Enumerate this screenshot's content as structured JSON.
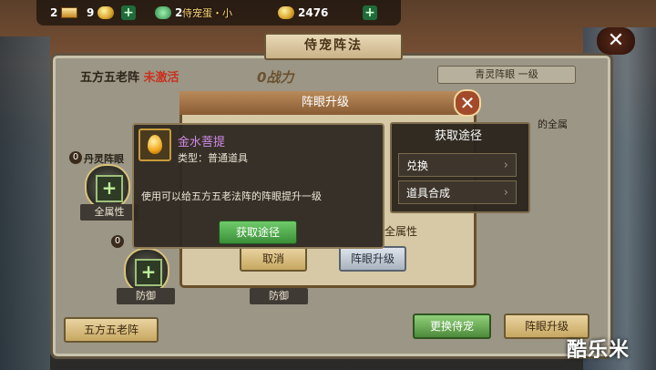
{
  "resources": [
    {
      "icon": "gold-bar-icon",
      "value": "2"
    },
    {
      "icon": "ingot-icon",
      "value": "9"
    },
    {
      "icon": "gem-icon",
      "value": "2"
    },
    {
      "icon": "coin-icon",
      "value": "2476"
    }
  ],
  "ticker": "侍宠蛋・小",
  "window_title": "侍宠阵法",
  "formation": {
    "name": "五方五老阵",
    "state": "未激活",
    "power": "0战力"
  },
  "right_tab": "青灵阵眼 一级",
  "right_text": "的全属",
  "slots": [
    {
      "badge": "0",
      "label": "丹灵阵眼"
    },
    {
      "badge": "",
      "label": "全属性"
    },
    {
      "badge": "0",
      "label": ""
    },
    {
      "badge": "",
      "label": "防御"
    },
    {
      "badge": "",
      "label": "防御"
    }
  ],
  "bottom_buttons": {
    "formation": "五方五老阵",
    "change_pet": "更换侍宠",
    "upgrade": "阵眼升级"
  },
  "dialog": {
    "title": "阵眼升级",
    "all_attr": "全属性",
    "cancel": "取消",
    "upgrade": "阵眼升级"
  },
  "item": {
    "name": "金水菩提",
    "type": "类型：普通道具",
    "desc": "使用可以给五方五老法阵的阵眼提升一级",
    "get_button": "获取途径"
  },
  "source": {
    "title": "获取途径",
    "items": [
      "兑换",
      "道具合成"
    ]
  },
  "watermark": "酷乐米",
  "colors": {
    "accent_green": "#4d8a3a",
    "item_purple": "#d08ae8",
    "warning_red": "#c8321f"
  }
}
